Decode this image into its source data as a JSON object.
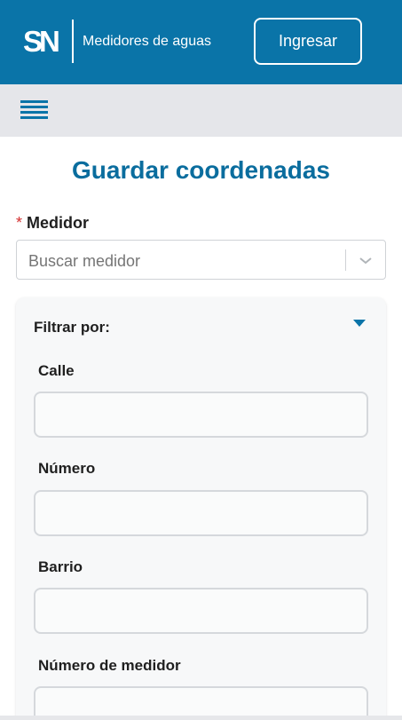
{
  "header": {
    "logo_text": "SN",
    "app_title": "Medidores de aguas",
    "login_label": "Ingresar",
    "brand_color": "#0a74a8"
  },
  "toolbar": {
    "menu_icon": "hamburger-menu-icon"
  },
  "page": {
    "title": "Guardar coordenadas"
  },
  "medidor": {
    "required_mark": "*",
    "label": "Medidor",
    "placeholder": "Buscar medidor",
    "chevron_icon": "chevron-down-icon"
  },
  "filter": {
    "title": "Filtrar por:",
    "toggle_icon": "caret-down-icon",
    "fields": [
      {
        "label": "Calle",
        "value": ""
      },
      {
        "label": "Número",
        "value": ""
      },
      {
        "label": "Barrio",
        "value": ""
      },
      {
        "label": "Número de medidor",
        "value": ""
      }
    ]
  }
}
